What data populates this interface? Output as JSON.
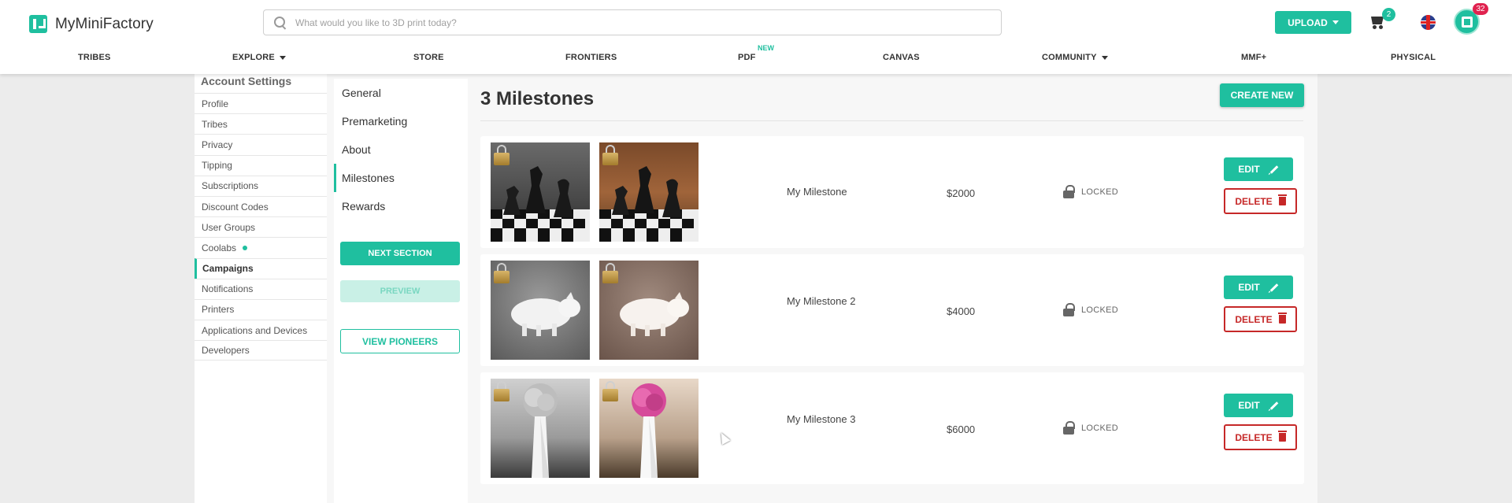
{
  "header": {
    "logo_text": "MyMiniFactory",
    "search_placeholder": "What would you like to 3D print today?",
    "upload_label": "UPLOAD",
    "cart_count": "2",
    "notification_count": "32"
  },
  "nav": {
    "items": [
      {
        "label": "TRIBES"
      },
      {
        "label": "EXPLORE",
        "dropdown": true
      },
      {
        "label": "STORE"
      },
      {
        "label": "FRONTIERS"
      },
      {
        "label": "PDF",
        "badge": "NEW"
      },
      {
        "label": "CANVAS"
      },
      {
        "label": "COMMUNITY",
        "dropdown": true
      },
      {
        "label": "MMF+"
      },
      {
        "label": "PHYSICAL"
      }
    ]
  },
  "settings": {
    "title": "Account Settings",
    "items": [
      {
        "label": "Profile"
      },
      {
        "label": "Tribes"
      },
      {
        "label": "Privacy"
      },
      {
        "label": "Tipping"
      },
      {
        "label": "Subscriptions"
      },
      {
        "label": "Discount Codes"
      },
      {
        "label": "User Groups"
      },
      {
        "label": "Coolabs",
        "dot": true
      },
      {
        "label": "Campaigns",
        "active": true
      },
      {
        "label": "Notifications"
      },
      {
        "label": "Printers"
      },
      {
        "label": "Applications and Devices"
      },
      {
        "label": "Developers"
      }
    ]
  },
  "sections": {
    "items": [
      {
        "label": "General"
      },
      {
        "label": "Premarketing"
      },
      {
        "label": "About"
      },
      {
        "label": "Milestones",
        "active": true
      },
      {
        "label": "Rewards"
      }
    ],
    "next_label": "NEXT SECTION",
    "preview_label": "PREVIEW",
    "pioneers_label": "VIEW PIONEERS"
  },
  "content": {
    "title": "3 Milestones",
    "create_label": "CREATE NEW",
    "milestones": [
      {
        "name": "My Milestone",
        "price": "$2000",
        "status": "LOCKED",
        "edit": "EDIT",
        "delete": "DELETE",
        "subject": "chess"
      },
      {
        "name": "My Milestone 2",
        "price": "$4000",
        "status": "LOCKED",
        "edit": "EDIT",
        "delete": "DELETE",
        "subject": "pig"
      },
      {
        "name": "My Milestone 3",
        "price": "$6000",
        "status": "LOCKED",
        "edit": "EDIT",
        "delete": "DELETE",
        "subject": "rose"
      }
    ]
  },
  "colors": {
    "accent": "#1fbf9f",
    "danger": "#c62828",
    "badge": "#e0224f"
  }
}
